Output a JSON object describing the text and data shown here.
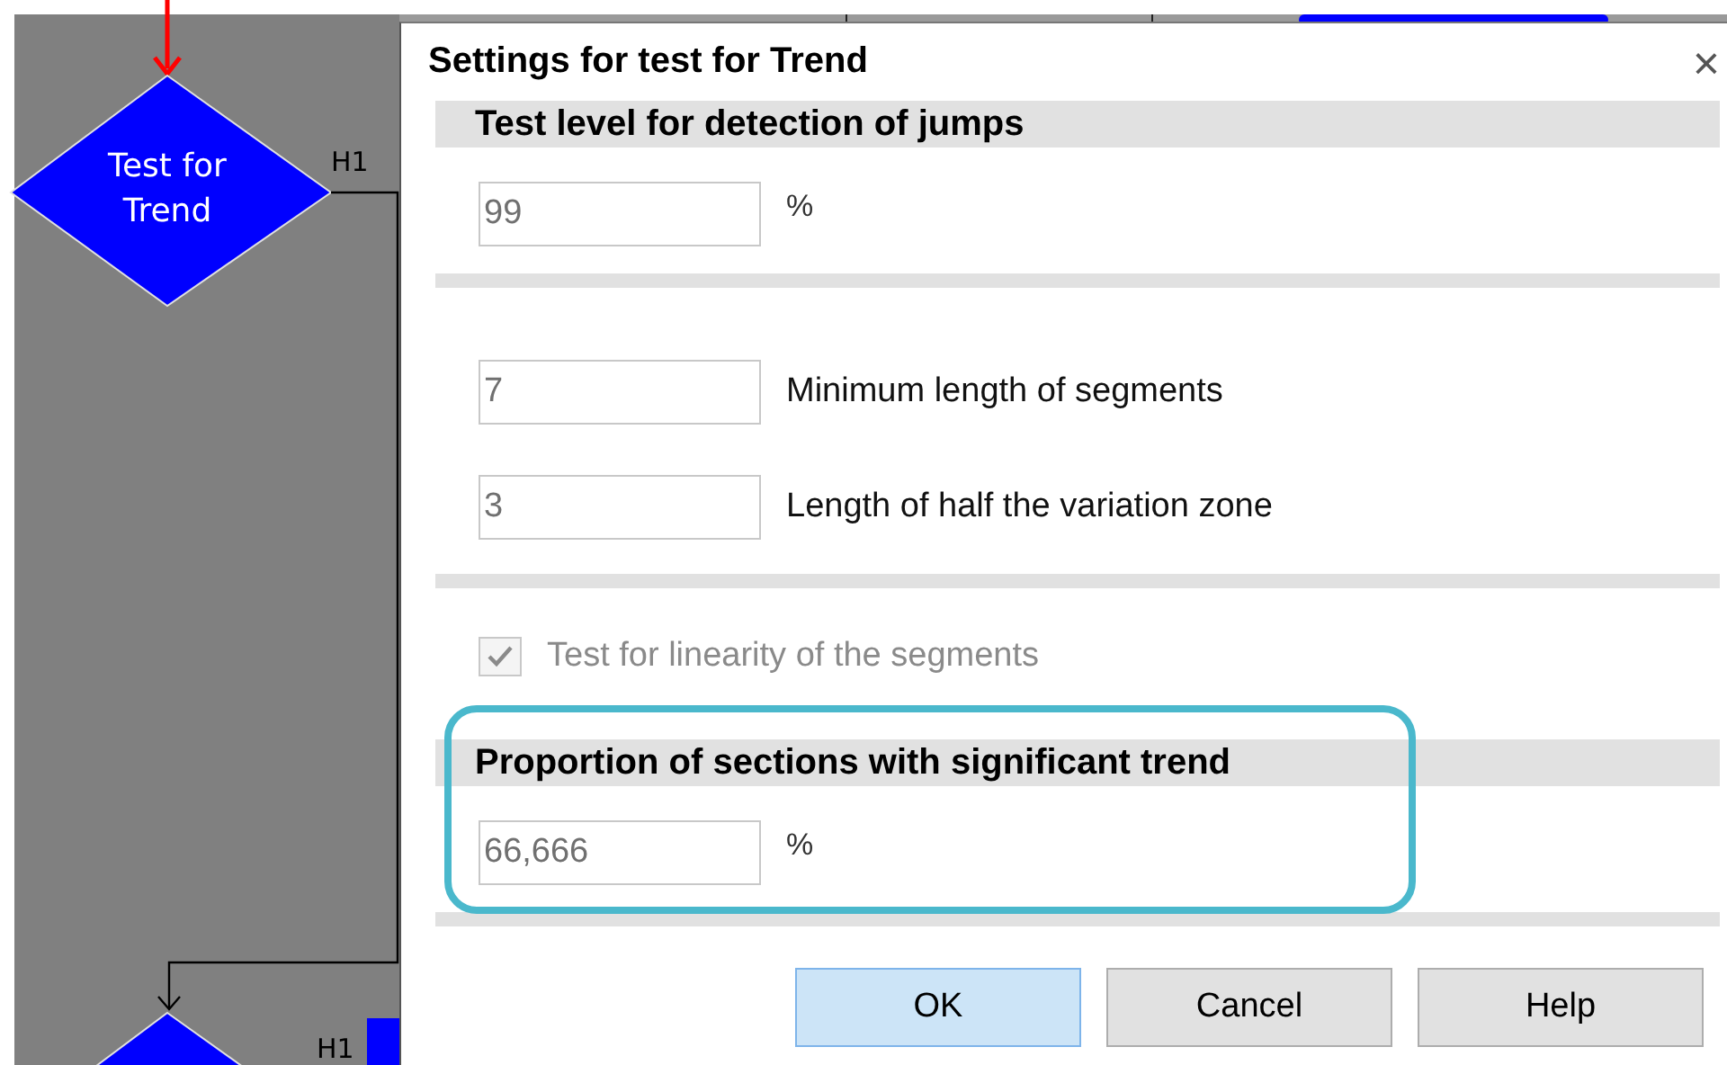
{
  "flowchart": {
    "top_node": {
      "label": "Test for Trend",
      "branch_label": "H1"
    },
    "bottom_node": {
      "branch_label": "H1"
    }
  },
  "dialog": {
    "title": "Settings for test for Trend",
    "close": "×",
    "sections": [
      {
        "heading": "Test level for detection of jumps",
        "highlighted": false,
        "rows": [
          {
            "kind": "field",
            "value": "99",
            "unit": "%"
          }
        ]
      },
      {
        "highlighted": false,
        "rows": [
          {
            "kind": "field",
            "value": "7",
            "label": "Minimum length of segments"
          },
          {
            "kind": "field",
            "value": "3",
            "label": "Length of half the variation zone"
          }
        ]
      },
      {
        "highlighted": false,
        "rows": [
          {
            "kind": "checkbox",
            "label": "Test for linearity of the segments",
            "checked": true,
            "disabled": true
          }
        ]
      },
      {
        "heading": "Proportion of sections with significant trend",
        "highlighted": true,
        "rows": [
          {
            "kind": "field",
            "value": "66,666",
            "unit": "%"
          }
        ]
      }
    ],
    "buttons": [
      {
        "label": "OK",
        "default": true
      },
      {
        "label": "Cancel",
        "default": false
      },
      {
        "label": "Help",
        "default": false
      }
    ]
  }
}
